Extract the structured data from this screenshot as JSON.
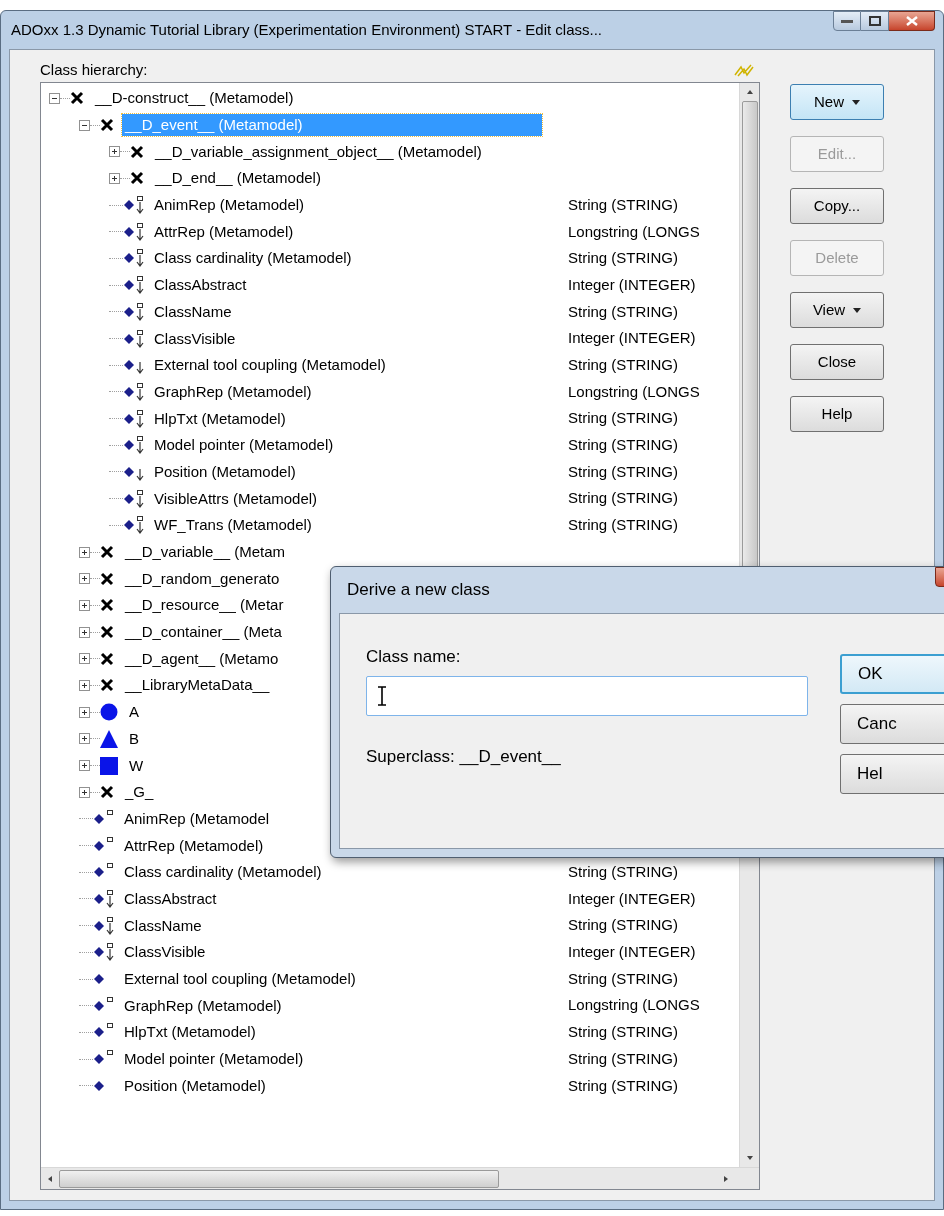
{
  "window": {
    "title": "ADOxx 1.3 Dynamic Tutorial Library (Experimentation Environment) START - Edit class..."
  },
  "hierarchy_label": "Class hierarchy:",
  "tree": [
    {
      "label": "__D-construct__ (Metamodel)",
      "kind": "class",
      "expanded": true,
      "selected": false,
      "children": [
        {
          "label": "__D_event__ (Metamodel)",
          "kind": "class",
          "expanded": true,
          "selected": true,
          "children": [
            {
              "label": "__D_variable_assignment_object__ (Metamodel)",
              "kind": "class",
              "expanded": false,
              "selected": false
            },
            {
              "label": "__D_end__ (Metamodel)",
              "kind": "class",
              "expanded": false,
              "selected": false
            },
            {
              "label": "AnimRep (Metamodel)",
              "kind": "attr-arrow-box",
              "selected": false,
              "type": "String (STRING)"
            },
            {
              "label": "AttrRep (Metamodel)",
              "kind": "attr-arrow-box",
              "selected": false,
              "type": "Longstring (LONGS"
            },
            {
              "label": "Class cardinality (Metamodel)",
              "kind": "attr-arrow-box",
              "selected": false,
              "type": "String (STRING)"
            },
            {
              "label": "ClassAbstract",
              "kind": "attr-arrow-box",
              "selected": false,
              "type": "Integer (INTEGER)"
            },
            {
              "label": "ClassName",
              "kind": "attr-arrow-box",
              "selected": false,
              "type": "String (STRING)"
            },
            {
              "label": "ClassVisible",
              "kind": "attr-arrow-box",
              "selected": false,
              "type": "Integer (INTEGER)"
            },
            {
              "label": "External tool coupling (Metamodel)",
              "kind": "attr-arrow",
              "selected": false,
              "type": "String (STRING)"
            },
            {
              "label": "GraphRep (Metamodel)",
              "kind": "attr-arrow-box",
              "selected": false,
              "type": "Longstring (LONGS"
            },
            {
              "label": "HlpTxt (Metamodel)",
              "kind": "attr-arrow-box",
              "selected": false,
              "type": "String (STRING)"
            },
            {
              "label": "Model pointer (Metamodel)",
              "kind": "attr-arrow-box",
              "selected": false,
              "type": "String (STRING)"
            },
            {
              "label": "Position (Metamodel)",
              "kind": "attr-arrow",
              "selected": false,
              "type": "String (STRING)"
            },
            {
              "label": "VisibleAttrs (Metamodel)",
              "kind": "attr-arrow-box",
              "selected": false,
              "type": "String (STRING)"
            },
            {
              "label": "WF_Trans (Metamodel)",
              "kind": "attr-arrow-box",
              "selected": false,
              "type": "String (STRING)"
            }
          ]
        },
        {
          "label": "__D_variable__ (Metam",
          "kind": "class",
          "expanded": false,
          "selected": false
        },
        {
          "label": "__D_random_generato",
          "kind": "class",
          "expanded": false,
          "selected": false
        },
        {
          "label": "__D_resource__ (Metar",
          "kind": "class",
          "expanded": false,
          "selected": false
        },
        {
          "label": "__D_container__ (Meta",
          "kind": "class",
          "expanded": false,
          "selected": false
        },
        {
          "label": "__D_agent__ (Metamo",
          "kind": "class",
          "expanded": false,
          "selected": false
        },
        {
          "label": "__LibraryMetaData__",
          "kind": "class",
          "expanded": false,
          "selected": false
        },
        {
          "label": "A",
          "kind": "circle",
          "expanded": false,
          "selected": false
        },
        {
          "label": "B",
          "kind": "triangle",
          "expanded": false,
          "selected": false
        },
        {
          "label": "W",
          "kind": "square",
          "expanded": false,
          "selected": false
        },
        {
          "label": "_G_",
          "kind": "class",
          "expanded": false,
          "selected": false
        },
        {
          "label": "AnimRep (Metamodel",
          "kind": "attr-box",
          "selected": false
        },
        {
          "label": "AttrRep (Metamodel)",
          "kind": "attr-box",
          "selected": false
        },
        {
          "label": "Class cardinality (Metamodel)",
          "kind": "attr-box",
          "selected": false,
          "type": "String (STRING)"
        },
        {
          "label": "ClassAbstract",
          "kind": "attr-arrow-box",
          "selected": false,
          "type": "Integer (INTEGER)"
        },
        {
          "label": "ClassName",
          "kind": "attr-arrow-box",
          "selected": false,
          "type": "String (STRING)"
        },
        {
          "label": "ClassVisible",
          "kind": "attr-arrow-box",
          "selected": false,
          "type": "Integer (INTEGER)"
        },
        {
          "label": "External tool coupling (Metamodel)",
          "kind": "attr",
          "selected": false,
          "type": "String (STRING)"
        },
        {
          "label": "GraphRep (Metamodel)",
          "kind": "attr-box",
          "selected": false,
          "type": "Longstring (LONGS"
        },
        {
          "label": "HlpTxt (Metamodel)",
          "kind": "attr-box",
          "selected": false,
          "type": "String (STRING)"
        },
        {
          "label": "Model pointer (Metamodel)",
          "kind": "attr-box",
          "selected": false,
          "type": "String (STRING)"
        },
        {
          "label": "Position (Metamodel)",
          "kind": "attr",
          "selected": false,
          "type": "String (STRING)"
        }
      ]
    }
  ],
  "buttons": [
    {
      "label": "New",
      "dropdown": true,
      "disabled": false,
      "default": true
    },
    {
      "label": "Edit...",
      "dropdown": false,
      "disabled": true,
      "default": false
    },
    {
      "label": "Copy...",
      "dropdown": false,
      "disabled": false,
      "default": false
    },
    {
      "label": "Delete",
      "dropdown": false,
      "disabled": true,
      "default": false
    },
    {
      "label": "View",
      "dropdown": true,
      "disabled": false,
      "default": false
    },
    {
      "label": "Close",
      "dropdown": false,
      "disabled": false,
      "default": false
    },
    {
      "label": "Help",
      "dropdown": false,
      "disabled": false,
      "default": false
    }
  ],
  "dialog": {
    "title": "Derive a new class",
    "field_label": "Class name:",
    "superclass": "Superclass: __D_event__",
    "buttons": [
      {
        "label": "OK",
        "default": true
      },
      {
        "label": "Canc",
        "default": false
      },
      {
        "label": "Hel",
        "default": false
      }
    ]
  }
}
